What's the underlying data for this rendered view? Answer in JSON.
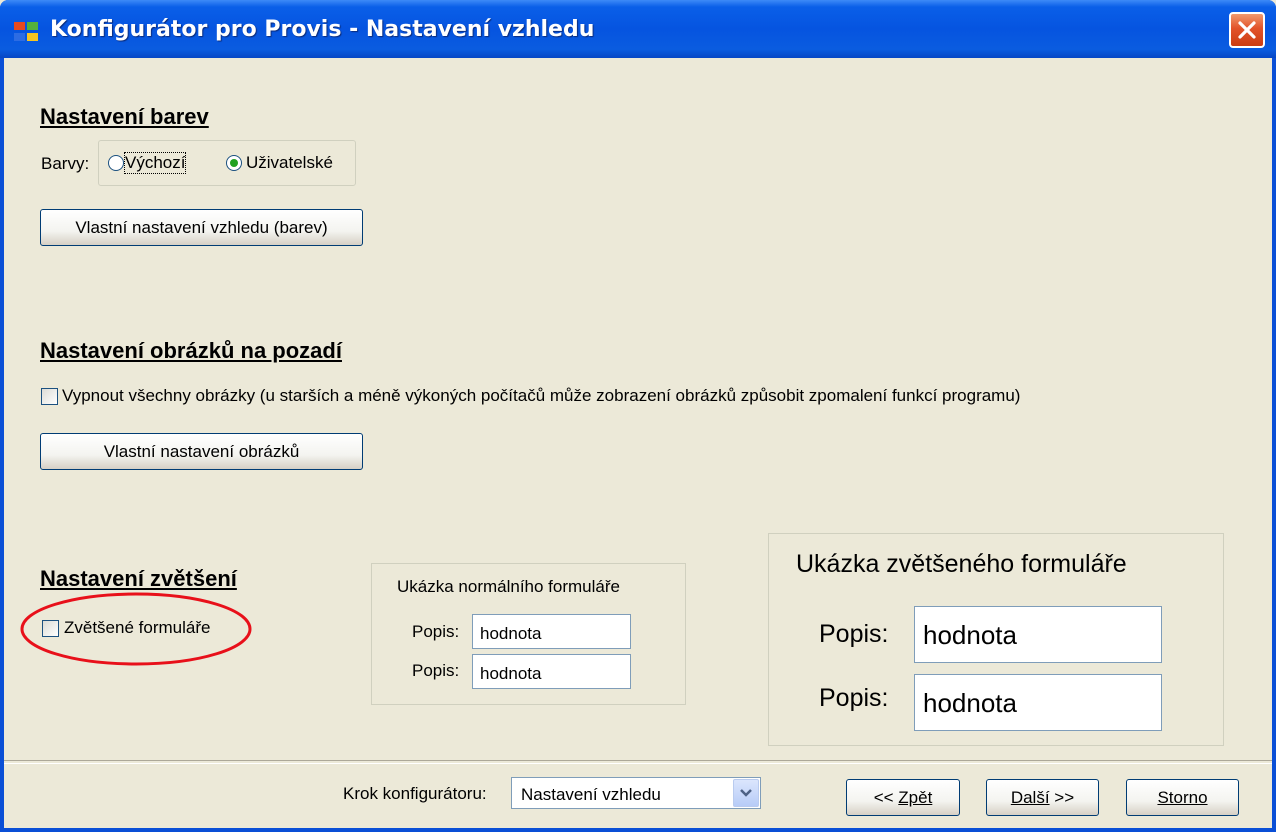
{
  "window": {
    "title": "Konfigurátor pro Provis - Nastavení vzhledu"
  },
  "colors_section": {
    "heading": "Nastavení barev",
    "label": "Barvy:",
    "options": [
      {
        "label": "Výchozí",
        "selected": false
      },
      {
        "label": "Uživatelské",
        "selected": true
      }
    ],
    "button": "Vlastní nastavení vzhledu (barev)"
  },
  "images_section": {
    "heading": "Nastavení obrázků na pozadí",
    "checkbox_label": "Vypnout všechny obrázky (u starších a méně výkoných počítačů může zobrazení obrázků způsobit zpomalení funkcí programu)",
    "checkbox_checked": false,
    "button": "Vlastní nastavení obrázků"
  },
  "zoom_section": {
    "heading": "Nastavení zvětšení",
    "checkbox_label": "Zvětšené formuláře",
    "checkbox_checked": false,
    "normal_sample": {
      "title": "Ukázka normálního formuláře",
      "rows": [
        {
          "label": "Popis:",
          "value": "hodnota"
        },
        {
          "label": "Popis:",
          "value": "hodnota"
        }
      ]
    },
    "large_sample": {
      "title": "Ukázka zvětšeného formuláře",
      "rows": [
        {
          "label": "Popis:",
          "value": "hodnota"
        },
        {
          "label": "Popis:",
          "value": "hodnota"
        }
      ]
    }
  },
  "footer": {
    "step_label": "Krok konfigurátoru:",
    "step_value": "Nastavení vzhledu",
    "back_prefix": "<< ",
    "back_label": "Zpět",
    "next_label": "Další",
    "next_suffix": " >>",
    "cancel_label": "Storno"
  },
  "colors": {
    "titlebar": "#0a5fe8",
    "client_bg": "#ece9d8",
    "annotation_ellipse": "#e8101a"
  }
}
